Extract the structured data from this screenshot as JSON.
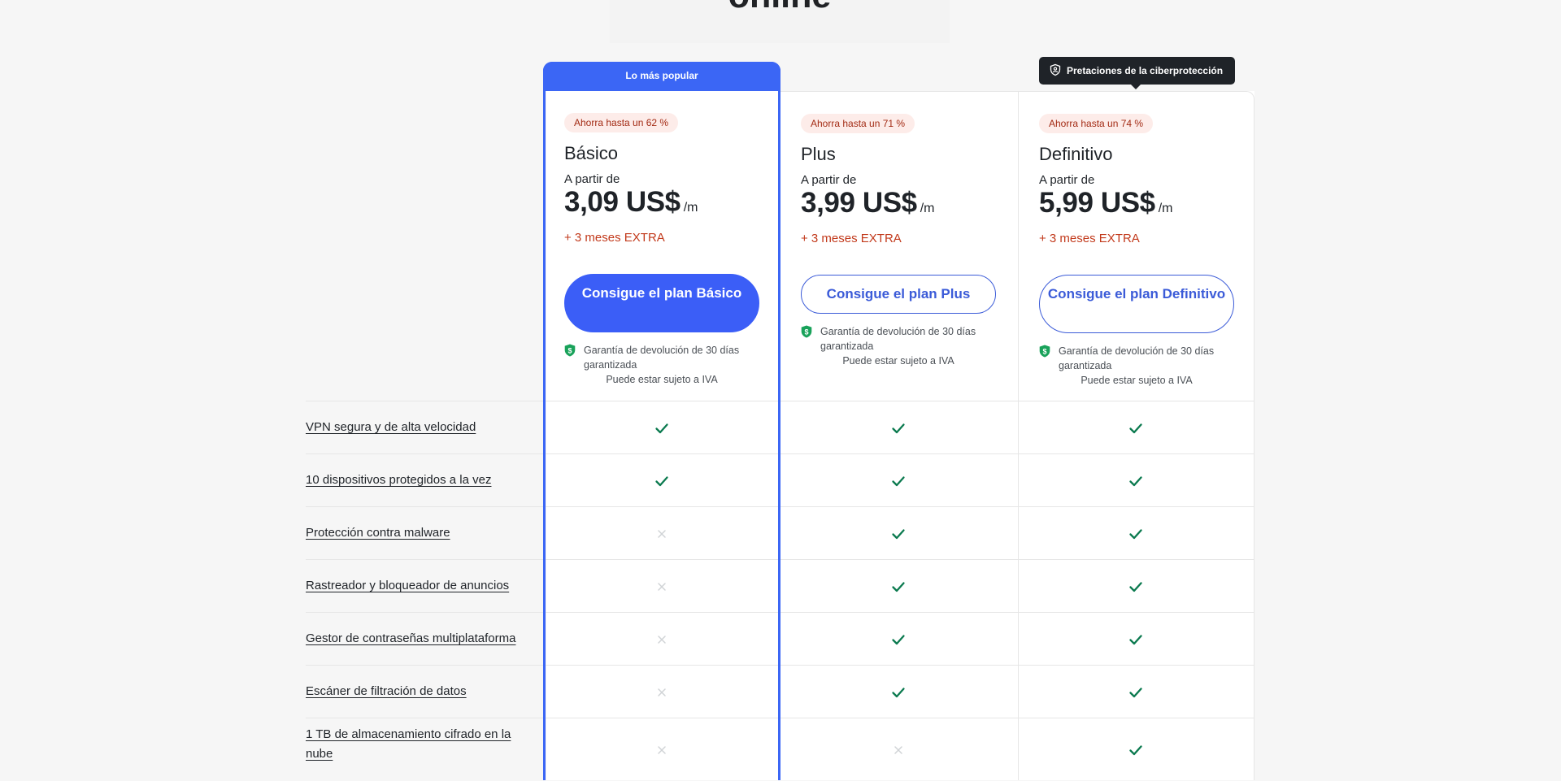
{
  "page": {
    "title": "online"
  },
  "popular_label": "Lo más popular",
  "tooltip": {
    "text": "Pretaciones de la ciberprotección",
    "icon": "shield-icon"
  },
  "plans": [
    {
      "id": "basic",
      "badge": "Ahorra hasta un 62 %",
      "name": "Básico",
      "from": "A partir de",
      "price": "3,09 US$",
      "period": "/m",
      "extra": "+ 3 meses EXTRA",
      "cta": "Consigue el plan Básico",
      "guarantee": "Garantía de devolución de 30 días garantizada",
      "vat": "Puede estar sujeto a IVA"
    },
    {
      "id": "plus",
      "badge": "Ahorra hasta un 71 %",
      "name": "Plus",
      "from": "A partir de",
      "price": "3,99 US$",
      "period": "/m",
      "extra": "+ 3 meses EXTRA",
      "cta": "Consigue el plan Plus",
      "guarantee": "Garantía de devolución de 30 días garantizada",
      "vat": "Puede estar sujeto a IVA"
    },
    {
      "id": "ultimate",
      "badge": "Ahorra hasta un 74 %",
      "name": "Definitivo",
      "from": "A partir de",
      "price": "5,99 US$",
      "period": "/m",
      "extra": "+ 3 meses EXTRA",
      "cta": "Consigue el plan Definitivo",
      "guarantee": "Garantía de devolución de 30 días garantizada",
      "vat": "Puede estar sujeto a IVA"
    }
  ],
  "features": [
    {
      "label": "VPN segura y de alta velocidad",
      "basic": true,
      "plus": true,
      "ultimate": true
    },
    {
      "label": "10 dispositivos protegidos a la vez",
      "basic": true,
      "plus": true,
      "ultimate": true
    },
    {
      "label": "Protección contra malware",
      "basic": false,
      "plus": true,
      "ultimate": true
    },
    {
      "label": "Rastreador y bloqueador de anuncios",
      "basic": false,
      "plus": true,
      "ultimate": true
    },
    {
      "label": "Gestor de contraseñas multiplataforma",
      "basic": false,
      "plus": true,
      "ultimate": true
    },
    {
      "label": "Escáner de filtración de datos",
      "basic": false,
      "plus": true,
      "ultimate": true
    },
    {
      "label": "1 TB de almacenamiento cifrado en la nube",
      "basic": false,
      "plus": false,
      "ultimate": true
    }
  ],
  "colors": {
    "accent": "#3b66f5",
    "check": "#0b7a4f",
    "cross": "#d0d3d6",
    "extra": "#c2391b"
  }
}
